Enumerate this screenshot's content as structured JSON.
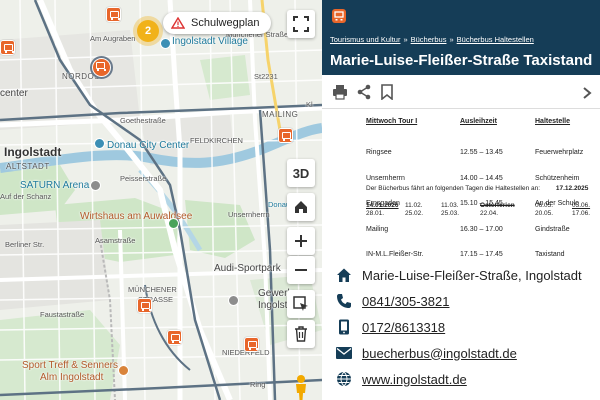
{
  "map": {
    "labels": {
      "city": "Ingolstadt",
      "altstadt": "ALTSTADT",
      "nordost": "NORDOS",
      "center": "center",
      "donau_city": "Donau City Center",
      "saturn": "SATURN Arena",
      "wirtshaus": "Wirtshaus am Auwaldsee",
      "audi_sportpark": "Audi-Sportpark",
      "gewerbe": "Gewerbeg",
      "gewerbe2": "Ingolsta",
      "sport_treff": "Sport Treff & Senners",
      "alm": "Alm Ingolstadt",
      "ingolstadt_village": "Ingolstadt Village",
      "feldkirchen": "FELDKIRCHEN",
      "mailing": "MAILING",
      "muenchener": "MÜNCHENER",
      "strasse": "STRASSE",
      "niederfeld": "NIEDERFELD",
      "donau": "Donau",
      "st2231": "St2231",
      "goethestrasse": "Goethestraße",
      "peisserstrasse": "Peisserstraße",
      "asamstrasse": "Asamstraße",
      "auf_der_schanz": "Auf der Schanz",
      "faustastrasse": "Faustastraße",
      "am_augraben": "Am Augraben",
      "berliner_str": "Berliner Str.",
      "muenchener_str": "Münchener Straße",
      "unsernherrn": "Unsernherrn",
      "kl": "Kl",
      "ring": "Ring"
    },
    "cluster_count": "2",
    "schulweg_label": "Schulwegplan",
    "controls": {
      "three_d": "3D"
    }
  },
  "panel": {
    "breadcrumb": [
      "Tourismus und Kultur",
      "Bücherbus",
      "Bücherbus Haltestellen"
    ],
    "breadcrumb_sep": "»",
    "title": "Marie-Luise-Fleißer-Straße Taxistand",
    "fahrplan": {
      "headers": [
        "Mittwoch Tour I",
        "Ausleihzeit",
        "Haltestelle"
      ],
      "stops": [
        "Ringsee",
        "Unsernherrn",
        "Ernsgaden",
        "Mailing",
        "IN-M.L.Fleißer-Str."
      ],
      "times": [
        "12.55 – 13.45",
        "14.00 – 14.45",
        "15.10 – 15.45",
        "16.30 – 17.00",
        "17.15 – 17.45"
      ],
      "haltestellen": [
        "Feuerwehrplatz",
        "Schützenheim",
        "An der Schule",
        "Gindstraße",
        "Taxistand"
      ],
      "note": "Der Bücherbus fährt an folgenden Tagen die Haltestellen an:",
      "note_date": "17.12.2025",
      "dates_row1": [
        "14.01.2026",
        "11.02.",
        "11.03.",
        "Osterferien",
        "06.05.",
        "03.06."
      ],
      "dates_row2": [
        "28.01.",
        "25.02.",
        "25.03.",
        "22.04.",
        "20.05.",
        "17.06."
      ]
    },
    "contacts": {
      "address": "Marie-Luise-Fleißer-Straße, Ingolstadt",
      "phone": "0841/305-3821",
      "mobile": "0172/8613318",
      "email": "buecherbus@ingolstadt.de",
      "web": "www.ingolstadt.de"
    }
  },
  "colors": {
    "header_bg": "#153d57",
    "bus_orange": "#e8662a",
    "cluster_yellow": "#f1b21a"
  }
}
